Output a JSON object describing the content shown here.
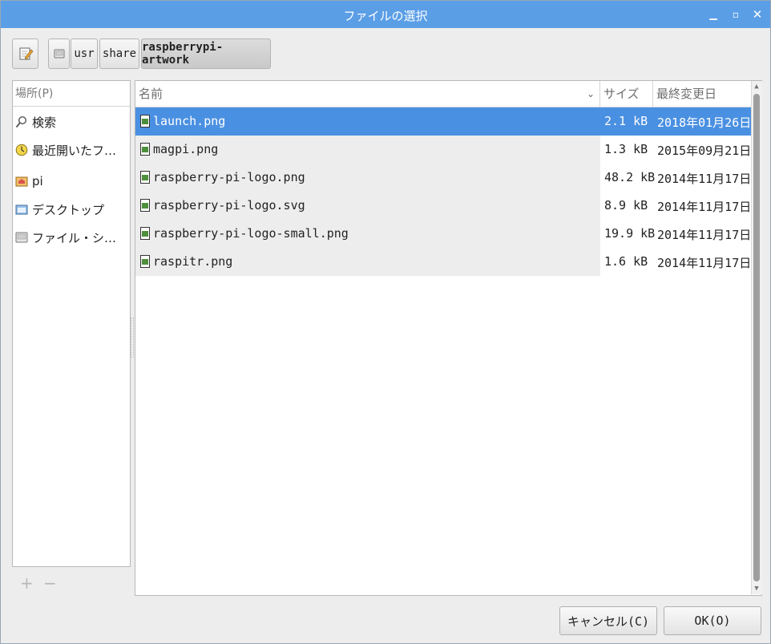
{
  "window": {
    "title": "ファイルの選択"
  },
  "path_bar": {
    "segments": [
      "usr",
      "share",
      "raspberrypi-artwork"
    ]
  },
  "places": {
    "header": "場所(P)",
    "items": [
      {
        "label": "検索",
        "icon": "search-icon"
      },
      {
        "label": "最近開いたフ…",
        "icon": "recent-icon"
      },
      {
        "label": "pi",
        "icon": "home-folder-icon"
      },
      {
        "label": "デスクトップ",
        "icon": "desktop-folder-icon"
      },
      {
        "label": "ファイル・シ…",
        "icon": "filesystem-icon"
      }
    ]
  },
  "file_list": {
    "columns": {
      "name": "名前",
      "size": "サイズ",
      "modified": "最終変更日"
    },
    "rows": [
      {
        "name": "launch.png",
        "size": "2.1 kB",
        "modified": "2018年01月26日",
        "selected": true
      },
      {
        "name": "magpi.png",
        "size": "1.3 kB",
        "modified": "2015年09月21日",
        "selected": false
      },
      {
        "name": "raspberry-pi-logo.png",
        "size": "48.2 kB",
        "modified": "2014年11月17日",
        "selected": false
      },
      {
        "name": "raspberry-pi-logo.svg",
        "size": "8.9 kB",
        "modified": "2014年11月17日",
        "selected": false
      },
      {
        "name": "raspberry-pi-logo-small.png",
        "size": "19.9 kB",
        "modified": "2014年11月17日",
        "selected": false
      },
      {
        "name": "raspitr.png",
        "size": "1.6 kB",
        "modified": "2014年11月17日",
        "selected": false
      }
    ]
  },
  "buttons": {
    "cancel": "キャンセル(C)",
    "ok": "OK(O)"
  },
  "colors": {
    "titlebar": "#5a9ee6",
    "selection": "#4a90e2"
  }
}
